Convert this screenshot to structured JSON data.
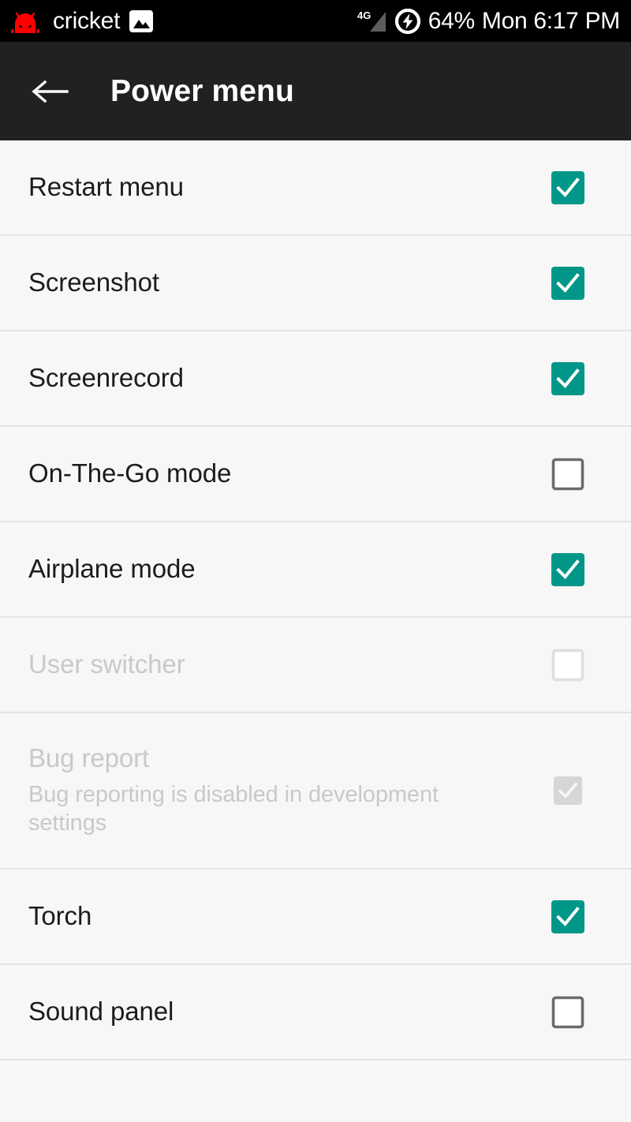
{
  "status_bar": {
    "carrier": "cricket",
    "battery_percent": "64%",
    "clock": "Mon 6:17 PM",
    "network_type": "4G",
    "icons": {
      "android_head": "android-head-icon",
      "photo": "photo-icon",
      "signal": "signal-4g-icon",
      "charging": "battery-charging-icon"
    },
    "colors": {
      "background": "#000000",
      "android_head": "#ff0000",
      "text": "#ffffff",
      "signal": "#6e6e6e"
    }
  },
  "toolbar": {
    "title": "Power menu",
    "back_icon": "back-arrow-icon",
    "background": "#212121"
  },
  "theme": {
    "accent": "#009688",
    "page_background": "#f7f7f7",
    "divider": "#e3e3e3",
    "text_primary": "#1c1c1c",
    "text_disabled": "#c9c9c9",
    "checkbox_unchecked_border": "#6b6b6b",
    "checkbox_disabled_fill": "#d6d6d6"
  },
  "preferences": [
    {
      "title": "Restart menu",
      "summary": "",
      "checked": true,
      "enabled": true
    },
    {
      "title": "Screenshot",
      "summary": "",
      "checked": true,
      "enabled": true
    },
    {
      "title": "Screenrecord",
      "summary": "",
      "checked": true,
      "enabled": true
    },
    {
      "title": "On-The-Go mode",
      "summary": "",
      "checked": false,
      "enabled": true
    },
    {
      "title": "Airplane mode",
      "summary": "",
      "checked": true,
      "enabled": true
    },
    {
      "title": "User switcher",
      "summary": "",
      "checked": false,
      "enabled": false
    },
    {
      "title": "Bug report",
      "summary": "Bug reporting is disabled in development settings",
      "checked": true,
      "enabled": false
    },
    {
      "title": "Torch",
      "summary": "",
      "checked": true,
      "enabled": true
    },
    {
      "title": "Sound panel",
      "summary": "",
      "checked": false,
      "enabled": true
    }
  ]
}
